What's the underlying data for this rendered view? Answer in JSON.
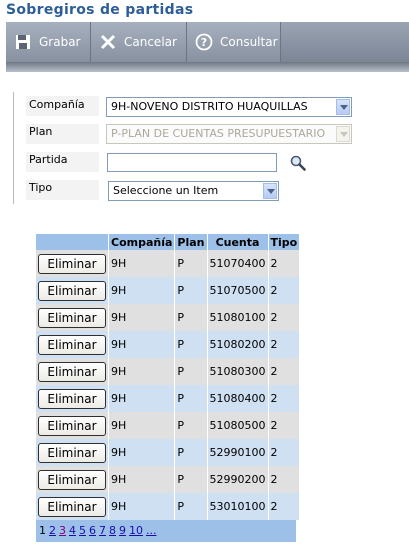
{
  "page": {
    "title": "Sobregiros de partidas"
  },
  "toolbar": {
    "save_label": "Grabar",
    "cancel_label": "Cancelar",
    "consult_label": "Consultar"
  },
  "form": {
    "compania_label": "Compañía",
    "compania_value": "9H-NOVENO DISTRITO HUAQUILLAS",
    "plan_label": "Plan",
    "plan_value": "P-PLAN DE CUENTAS PRESUPUESTARIO",
    "partida_label": "Partida",
    "partida_value": "",
    "tipo_label": "Tipo",
    "tipo_value": "Seleccione un Item"
  },
  "grid": {
    "headers": [
      "",
      "Compañía",
      "Plan",
      "Cuenta",
      "Tipo"
    ],
    "delete_label": "Eliminar",
    "rows": [
      {
        "compania": "9H",
        "plan": "P",
        "cuenta": "51070400",
        "tipo": "2"
      },
      {
        "compania": "9H",
        "plan": "P",
        "cuenta": "51070500",
        "tipo": "2"
      },
      {
        "compania": "9H",
        "plan": "P",
        "cuenta": "51080100",
        "tipo": "2"
      },
      {
        "compania": "9H",
        "plan": "P",
        "cuenta": "51080200",
        "tipo": "2"
      },
      {
        "compania": "9H",
        "plan": "P",
        "cuenta": "51080300",
        "tipo": "2"
      },
      {
        "compania": "9H",
        "plan": "P",
        "cuenta": "51080400",
        "tipo": "2"
      },
      {
        "compania": "9H",
        "plan": "P",
        "cuenta": "51080500",
        "tipo": "2"
      },
      {
        "compania": "9H",
        "plan": "P",
        "cuenta": "52990100",
        "tipo": "2"
      },
      {
        "compania": "9H",
        "plan": "P",
        "cuenta": "52990200",
        "tipo": "2"
      },
      {
        "compania": "9H",
        "plan": "P",
        "cuenta": "53010100",
        "tipo": "2"
      }
    ],
    "pager": {
      "current": "1",
      "pages": [
        "2",
        "3",
        "4",
        "5",
        "6",
        "7",
        "8",
        "9",
        "10",
        "..."
      ],
      "visited": [
        "3"
      ]
    }
  }
}
